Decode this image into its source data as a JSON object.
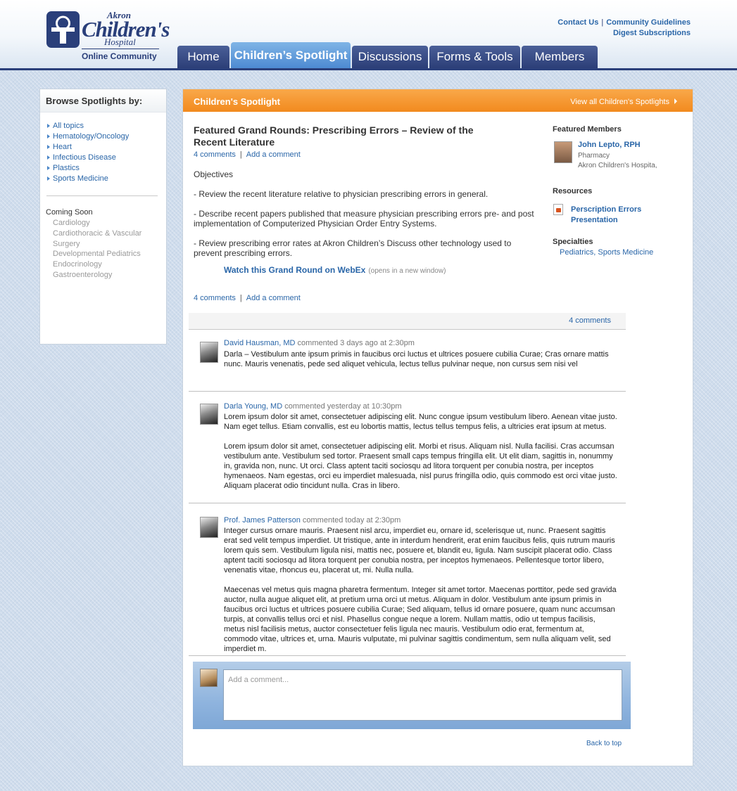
{
  "brand": {
    "akron": "Akron",
    "childrens": "Children's",
    "hospital": "Hospital",
    "online": "Online Community",
    "navy": "#2a3f7a",
    "orange": "#f28a1e",
    "link": "#2a66a8"
  },
  "toplinks": {
    "contact": "Contact Us",
    "separator": "|",
    "guidelines": "Community Guidelines",
    "digest": "Digest Subscriptions"
  },
  "nav": {
    "home": "Home",
    "spotlight": "Children’s Spotlight",
    "discussions": "Discussions",
    "forms": "Forms & Tools",
    "members": "Members",
    "active": "Children’s Spotlight"
  },
  "sidebar": {
    "title": "Browse Spotlights by:",
    "topics": [
      {
        "label": "All topics"
      },
      {
        "label": "Hematology/Oncology"
      },
      {
        "label": "Heart"
      },
      {
        "label": "Infectious Disease"
      },
      {
        "label": "Plastics"
      },
      {
        "label": "Sports Medicine"
      }
    ],
    "coming_soon": {
      "heading": "Coming Soon",
      "items": [
        "Cardiology",
        "Cardiothoracic & Vascular Surgery",
        "Developmental Pediatrics",
        "Endocrinology",
        "Gastroenterology"
      ]
    }
  },
  "panel": {
    "title": "Children's Spotlight",
    "view_all": "View all Children's Spotlights"
  },
  "article": {
    "title": "Featured Grand Rounds: Prescribing Errors – Review of the Recent Literature",
    "comments_link": "4 comments",
    "separator": "|",
    "add_comment": "Add a comment",
    "objectives": "Objectives",
    "points": [
      "- Review the recent literature relative to physician prescribing errors in general.",
      "- Describe recent papers published that measure physician prescribing errors pre- and post implementation of Computerized Physician Order Entry Systems.",
      "- Review prescribing error rates at Akron Children’s Discuss other technology used to prevent prescribing errors."
    ],
    "watch_link": "Watch this Grand Round on WebEx",
    "watch_note": "(opens in a new window)"
  },
  "right": {
    "featured_heading": "Featured Members",
    "member": {
      "name": "John Lepto, RPH",
      "role": "Pharmacy",
      "org": "Akron Children's Hospita,"
    },
    "resources_heading": "Resources",
    "resource_label": "Perscription Errors Presentation",
    "specialties_heading": "Specialties",
    "specialties_value": "Pediatrics, Sports Medicine"
  },
  "comments": {
    "count_label": "4 comments",
    "items": [
      {
        "author": "David Hausman, MD",
        "meta": "commented 3 days ago at 2:30pm",
        "paragraphs": [
          "Darla – Vestibulum ante ipsum primis in faucibus orci luctus et ultrices posuere cubilia Curae; Cras ornare mattis nunc. Mauris venenatis, pede sed aliquet vehicula, lectus tellus pulvinar neque, non cursus sem nisi vel"
        ]
      },
      {
        "author": "Darla Young, MD",
        "meta": "commented yesterday at 10:30pm",
        "paragraphs": [
          "Lorem ipsum dolor sit amet, consectetuer adipiscing elit. Nunc congue ipsum vestibulum libero. Aenean vitae justo. Nam eget tellus. Etiam convallis, est eu lobortis mattis, lectus tellus tempus felis, a ultricies erat ipsum at metus.",
          "Lorem ipsum dolor sit amet, consectetuer adipiscing elit. Morbi et risus. Aliquam nisl. Nulla facilisi. Cras accumsan vestibulum ante. Vestibulum sed tortor. Praesent small caps tempus fringilla elit. Ut elit diam, sagittis in, nonummy in, gravida non, nunc. Ut orci. Class aptent taciti sociosqu ad litora torquent per conubia nostra, per inceptos hymenaeos. Nam egestas, orci eu imperdiet malesuada, nisl purus fringilla odio, quis commodo est orci vitae justo. Aliquam placerat odio tincidunt nulla. Cras in libero."
        ]
      },
      {
        "author": "Prof. James Patterson",
        "meta": "commented today at 2:30pm",
        "paragraphs": [
          "Integer cursus ornare mauris. Praesent nisl arcu, imperdiet eu, ornare id, scelerisque ut, nunc. Praesent sagittis erat sed velit tempus imperdiet. Ut tristique, ante in interdum hendrerit, erat enim faucibus felis, quis rutrum mauris lorem quis sem. Vestibulum ligula nisi, mattis nec, posuere et, blandit eu, ligula. Nam suscipit placerat odio. Class aptent taciti sociosqu ad litora torquent per conubia nostra, per inceptos hymenaeos. Pellentesque tortor libero, venenatis vitae, rhoncus eu, placerat ut, mi. Nulla nulla.",
          "Maecenas vel metus quis magna pharetra fermentum. Integer sit amet tortor. Maecenas porttitor, pede sed gravida auctor, nulla augue aliquet elit, at pretium urna orci ut metus. Aliquam in dolor. Vestibulum ante ipsum primis in faucibus orci luctus et ultrices posuere cubilia Curae; Sed aliquam, tellus id ornare posuere, quam nunc accumsan turpis, at convallis tellus orci et nisl. Phasellus congue neque a lorem. Nullam mattis, odio ut tempus facilisis, metus nisl facilisis metus, auctor consectetuer felis ligula nec mauris. Vestibulum odio erat, fermentum at, commodo vitae, ultrices et, urna. Mauris vulputate, mi pulvinar sagittis condimentum, sem nulla aliquam velit, sed imperdiet m."
        ]
      }
    ],
    "add_placeholder": "Add a comment..."
  },
  "back_to_top": "Back to top"
}
